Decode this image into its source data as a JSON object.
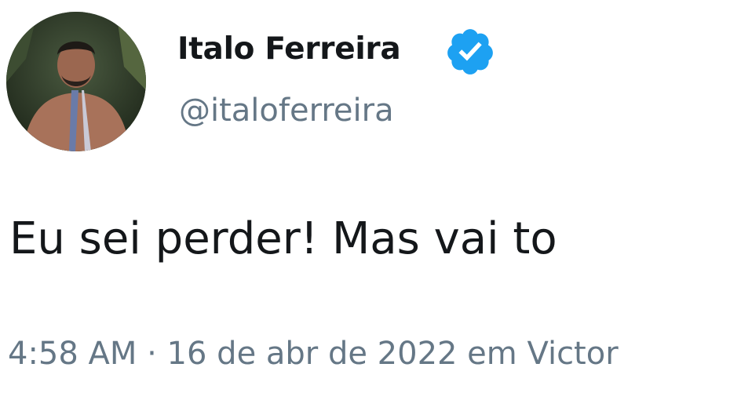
{
  "tweet": {
    "author": {
      "display_name": "Italo Ferreira",
      "handle": "@italoferreira",
      "verified": true,
      "avatar_icon": "profile-photo"
    },
    "text": "Eu sei perder! Mas vai to",
    "meta": "4:58 AM · 16 de abr de 2022 em Victor"
  },
  "colors": {
    "text": "#14171a",
    "secondary_text": "#657786",
    "verified_badge": "#1da1f2",
    "background": "#ffffff"
  }
}
